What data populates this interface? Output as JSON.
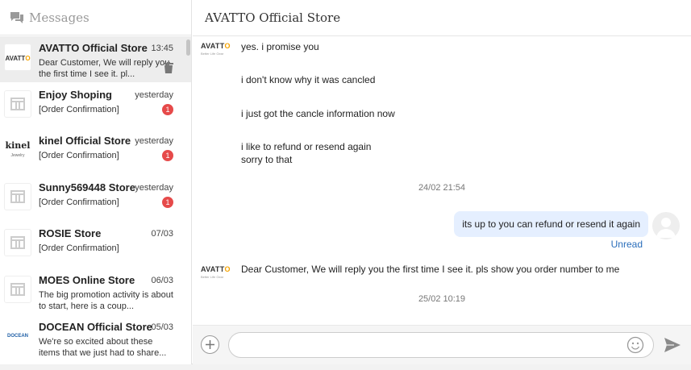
{
  "sidebar": {
    "title": "Messages",
    "conversations": [
      {
        "name": "AVATTO Official Store",
        "time": "13:45",
        "preview": "Dear Customer, We will reply you the first time I see it. pl...",
        "badge": "",
        "logo": "AVATTO"
      },
      {
        "name": "Enjoy Shoping",
        "time": "yesterday",
        "preview": "[Order Confirmation]",
        "badge": "1",
        "logo": ""
      },
      {
        "name": "kinel Official Store",
        "time": "yesterday",
        "preview": "[Order Confirmation]",
        "badge": "1",
        "logo": "kinel"
      },
      {
        "name": "Sunny569448 Store",
        "time": "yesterday",
        "preview": "[Order Confirmation]",
        "badge": "1",
        "logo": ""
      },
      {
        "name": "ROSIE Store",
        "time": "07/03",
        "preview": "[Order Confirmation]",
        "badge": "",
        "logo": ""
      },
      {
        "name": "MOES Online Store",
        "time": "06/03",
        "preview": "The big promotion activity is about to start, here is a coup...",
        "badge": "",
        "logo": ""
      },
      {
        "name": "DOCEAN Official Store",
        "time": "05/03",
        "preview": "We're so excited about these items that we just had to share...",
        "badge": "",
        "logo": "DOCEAN"
      }
    ]
  },
  "chat": {
    "title": "AVATTO Official Store",
    "messages": [
      {
        "text": "yes. i promise you"
      },
      {
        "text": "i don't know why it was cancled"
      },
      {
        "text": "i just got the cancle information now"
      },
      {
        "text": "i like to refund or resend again"
      },
      {
        "text": "sorry to that"
      }
    ],
    "timestamp_1": "24/02 21:54",
    "outgoing": "its up to you can refund or resend it again",
    "outgoing_status": "Unread",
    "reply": "Dear Customer, We will reply you the first time I see it. pls show you order number to me",
    "timestamp_2": "25/02 10:19",
    "input_placeholder": ""
  },
  "colors": {
    "badge": "#e64a4a",
    "outgoing_bubble": "#e5efff",
    "link": "#2a6ebb",
    "active_row": "#ededed"
  },
  "icons": {
    "header": "chat-bubbles-icon",
    "store": "store-icon",
    "delete": "trash-icon",
    "add": "plus-circle-icon",
    "emoji": "smiley-icon",
    "send": "send-arrow-icon"
  }
}
